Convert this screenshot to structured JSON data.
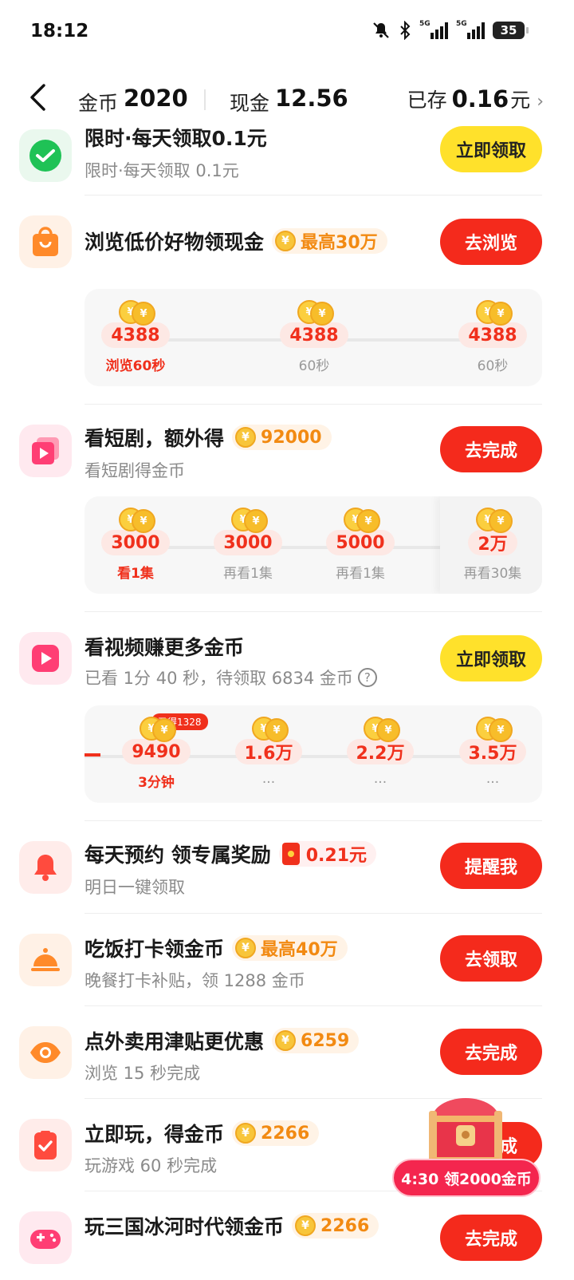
{
  "status": {
    "time": "18:12",
    "battery": "35",
    "net1": "5G",
    "net2": "5G"
  },
  "header": {
    "coins_label": "金币",
    "coins_value": "2020",
    "cash_label": "现金",
    "cash_value": "12.56",
    "saved_label": "已存",
    "saved_value": "0.16",
    "saved_unit": "元"
  },
  "tasks": [
    {
      "title": "限时·每天领取0.1元",
      "subtitle": "限时·每天领取 0.1元",
      "button": "立即领取"
    },
    {
      "title": "浏览低价好物领现金",
      "pill": "最高30万",
      "button": "去浏览",
      "nodes": [
        {
          "value": "4388",
          "label": "浏览60秒"
        },
        {
          "value": "4388",
          "label": "60秒"
        },
        {
          "value": "4388",
          "label": "60秒"
        }
      ]
    },
    {
      "title": "看短剧，额外得",
      "pill": "92000",
      "subtitle": "看短剧得金币",
      "button": "去完成",
      "nodes": [
        {
          "value": "3000",
          "label": "看1集"
        },
        {
          "value": "3000",
          "label": "再看1集"
        },
        {
          "value": "5000",
          "label": "再看1集"
        },
        {
          "value": "2万",
          "label": "再看30集"
        }
      ]
    },
    {
      "title": "看视频赚更多金币",
      "subtitle": "已看 1分 40 秒，待领取 6834 金币",
      "button": "立即领取",
      "tag": "已得1328",
      "nodes": [
        {
          "value": "9490",
          "label": "3分钟"
        },
        {
          "value": "1.6万",
          "label": "..."
        },
        {
          "value": "2.2万",
          "label": "..."
        },
        {
          "value": "3.5万",
          "label": "..."
        }
      ]
    },
    {
      "title": "每天预约 领专属奖励",
      "pill": "0.21元",
      "subtitle": "明日一键领取",
      "button": "提醒我"
    },
    {
      "title": "吃饭打卡领金币",
      "pill": "最高40万",
      "subtitle": "晚餐打卡补贴，领 1288 金币",
      "button": "去领取"
    },
    {
      "title": "点外卖用津贴更优惠",
      "pill": "6259",
      "subtitle": "浏览 15 秒完成",
      "button": "去完成"
    },
    {
      "title": "立即玩，得金币",
      "pill": "2266",
      "subtitle": "玩游戏 60 秒完成",
      "button": "去完成"
    },
    {
      "title": "玩三国冰河时代领金币",
      "pill": "2266",
      "button": "去完成"
    }
  ],
  "float": {
    "badge": "4:30 领2000金币"
  },
  "icons": {
    "coin_symbol": "¥",
    "wechat": "wechat-icon",
    "bag": "shopping-bag-icon",
    "drama": "short-drama-icon",
    "video": "video-play-icon",
    "bell": "bell-icon",
    "cloche": "dining-cloche-icon",
    "eye": "eye-icon",
    "game": "game-icon",
    "gamepad": "gamepad-icon"
  },
  "colors": {
    "accent_red": "#f42a1c",
    "accent_yellow": "#ffe12b",
    "coin_orange": "#f28a12"
  }
}
